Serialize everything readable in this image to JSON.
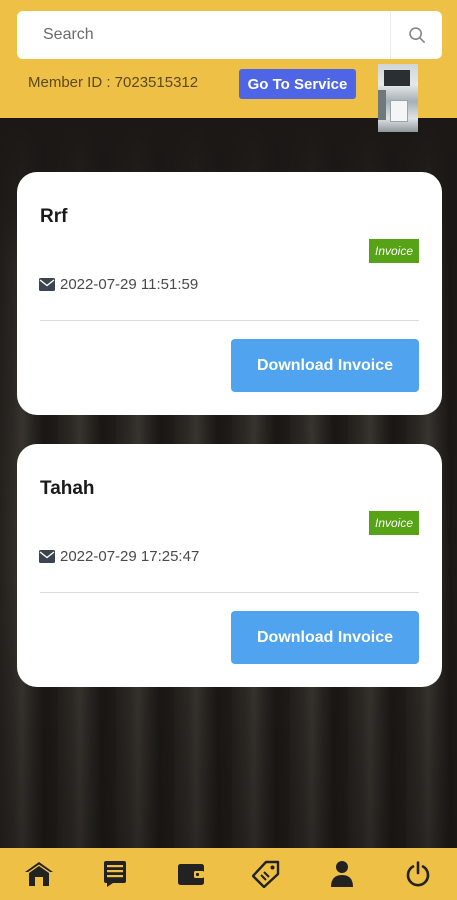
{
  "search": {
    "placeholder": "Search",
    "icon": "search-icon"
  },
  "header": {
    "member_id": "Member ID : 7023515312",
    "service_button": "Go To Service",
    "avatar": "profile-photo"
  },
  "cards": [
    {
      "title": "Rrf",
      "badge": "Invoice",
      "datetime": "2022-07-29 11:51:59",
      "button": "Download Invoice"
    },
    {
      "title": "Tahah",
      "badge": "Invoice",
      "datetime": "2022-07-29 17:25:47",
      "button": "Download Invoice"
    }
  ],
  "bottom_nav": {
    "items": [
      "home-icon",
      "list-icon",
      "wallet-icon",
      "tag-icon",
      "user-icon",
      "power-icon"
    ]
  },
  "colors": {
    "header_bg": "#eec046",
    "service_button": "#4e66e6",
    "badge": "#56a316",
    "download_button": "#50a3ee",
    "nav_icon": "#222222"
  }
}
